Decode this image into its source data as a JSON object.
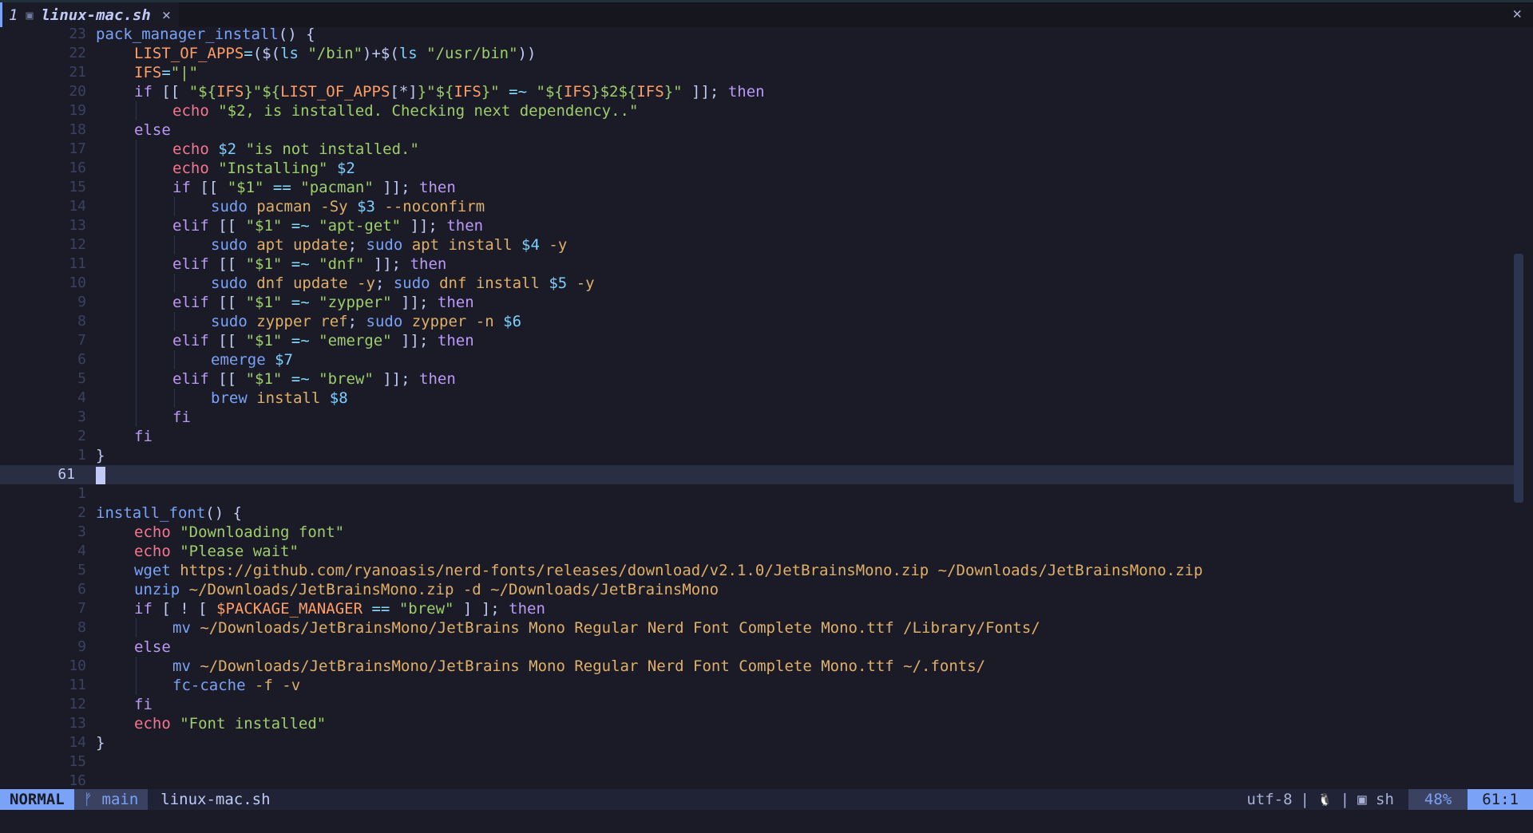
{
  "tab": {
    "number": "1",
    "filename": "linux-mac.sh",
    "close_glyph": "×"
  },
  "window_close_glyph": "✕",
  "lines": [
    {
      "n": "23",
      "code": "<span class=\"fn\">pack_manager_install</span><span class=\"p\">() {</span>"
    },
    {
      "n": "22",
      "indent": 1,
      "code": "<span class=\"c\">LIST_OF_APPS</span><span class=\"o\">=</span><span class=\"p\">($(</span><span class=\"f\">ls</span> <span class=\"s\">\"/bin\"</span><span class=\"p\">)+$(</span><span class=\"f\">ls</span> <span class=\"s\">\"/usr/bin\"</span><span class=\"p\">))</span>"
    },
    {
      "n": "21",
      "indent": 1,
      "code": "<span class=\"c\">IFS</span><span class=\"o\">=</span><span class=\"s\">\"|\"</span>"
    },
    {
      "n": "20",
      "indent": 1,
      "code": "<span class=\"k\">if</span> <span class=\"p\">[[</span> <span class=\"s\">\"${</span><span class=\"c\">IFS</span><span class=\"s\">}\"${</span><span class=\"c\">LIST_OF_APPS</span><span class=\"p\">[*]</span><span class=\"s\">}\"${</span><span class=\"c\">IFS</span><span class=\"s\">}\"</span> <span class=\"o\">=~</span> <span class=\"s\">\"${</span><span class=\"c\">IFS</span><span class=\"s\">}$2${</span><span class=\"c\">IFS</span><span class=\"s\">}\"</span> <span class=\"p\">]];</span> <span class=\"k\">then</span>"
    },
    {
      "n": "19",
      "indent": 2,
      "code": "<span class=\"e\">echo</span> <span class=\"s\">\"$2, is installed. Checking next dependency..\"</span>"
    },
    {
      "n": "18",
      "indent": 1,
      "code": "<span class=\"k\">else</span>"
    },
    {
      "n": "17",
      "indent": 2,
      "code": "<span class=\"e\">echo</span> <span class=\"f\">$2</span> <span class=\"s\">\"is not installed.\"</span>"
    },
    {
      "n": "16",
      "indent": 2,
      "code": "<span class=\"e\">echo</span> <span class=\"s\">\"Installing\"</span> <span class=\"f\">$2</span>"
    },
    {
      "n": "15",
      "indent": 2,
      "code": "<span class=\"k\">if</span> <span class=\"p\">[[</span> <span class=\"s\">\"$1\"</span> <span class=\"o\">==</span> <span class=\"s\">\"pacman\"</span> <span class=\"p\">]];</span> <span class=\"k\">then</span>"
    },
    {
      "n": "14",
      "indent": 3,
      "code": "<span class=\"fn\">sudo</span> <span class=\"y\">pacman -Sy</span> <span class=\"f\">$3</span> <span class=\"y\">--noconfirm</span>"
    },
    {
      "n": "13",
      "indent": 2,
      "code": "<span class=\"k\">elif</span> <span class=\"p\">[[</span> <span class=\"s\">\"$1\"</span> <span class=\"o\">=~</span> <span class=\"s\">\"apt-get\"</span> <span class=\"p\">]];</span> <span class=\"k\">then</span>"
    },
    {
      "n": "12",
      "indent": 3,
      "code": "<span class=\"fn\">sudo</span> <span class=\"y\">apt update</span><span class=\"p\">;</span> <span class=\"fn\">sudo</span> <span class=\"y\">apt install</span> <span class=\"f\">$4</span> <span class=\"y\">-y</span>"
    },
    {
      "n": "11",
      "indent": 2,
      "code": "<span class=\"k\">elif</span> <span class=\"p\">[[</span> <span class=\"s\">\"$1\"</span> <span class=\"o\">=~</span> <span class=\"s\">\"dnf\"</span> <span class=\"p\">]];</span> <span class=\"k\">then</span>"
    },
    {
      "n": "10",
      "indent": 3,
      "code": "<span class=\"fn\">sudo</span> <span class=\"y\">dnf update -y</span><span class=\"p\">;</span> <span class=\"fn\">sudo</span> <span class=\"y\">dnf install</span> <span class=\"f\">$5</span> <span class=\"y\">-y</span>"
    },
    {
      "n": "9",
      "indent": 2,
      "code": "<span class=\"k\">elif</span> <span class=\"p\">[[</span> <span class=\"s\">\"$1\"</span> <span class=\"o\">=~</span> <span class=\"s\">\"zypper\"</span> <span class=\"p\">]];</span> <span class=\"k\">then</span>"
    },
    {
      "n": "8",
      "indent": 3,
      "code": "<span class=\"fn\">sudo</span> <span class=\"y\">zypper ref</span><span class=\"p\">;</span> <span class=\"fn\">sudo</span> <span class=\"y\">zypper -n</span> <span class=\"f\">$6</span>"
    },
    {
      "n": "7",
      "indent": 2,
      "code": "<span class=\"k\">elif</span> <span class=\"p\">[[</span> <span class=\"s\">\"$1\"</span> <span class=\"o\">=~</span> <span class=\"s\">\"emerge\"</span> <span class=\"p\">]];</span> <span class=\"k\">then</span>"
    },
    {
      "n": "6",
      "indent": 3,
      "code": "<span class=\"fn\">emerge</span> <span class=\"f\">$7</span>"
    },
    {
      "n": "5",
      "indent": 2,
      "code": "<span class=\"k\">elif</span> <span class=\"p\">[[</span> <span class=\"s\">\"$1\"</span> <span class=\"o\">=~</span> <span class=\"s\">\"brew\"</span> <span class=\"p\">]];</span> <span class=\"k\">then</span>"
    },
    {
      "n": "4",
      "indent": 3,
      "code": "<span class=\"fn\">brew</span> <span class=\"y\">install</span> <span class=\"f\">$8</span>"
    },
    {
      "n": "3",
      "indent": 2,
      "code": "<span class=\"k\">fi</span>"
    },
    {
      "n": "2",
      "indent": 1,
      "code": "<span class=\"k\">fi</span>"
    },
    {
      "n": "1",
      "code": "<span class=\"p\">}</span>"
    },
    {
      "n": "61",
      "cur": true,
      "code": ""
    },
    {
      "n": "1",
      "code": ""
    },
    {
      "n": "2",
      "code": "<span class=\"fn\">install_font</span><span class=\"p\">() {</span>"
    },
    {
      "n": "3",
      "indent": 1,
      "code": "<span class=\"e\">echo</span> <span class=\"s\">\"Downloading font\"</span>"
    },
    {
      "n": "4",
      "indent": 1,
      "code": "<span class=\"e\">echo</span> <span class=\"s\">\"Please wait\"</span>"
    },
    {
      "n": "5",
      "indent": 1,
      "code": "<span class=\"fn\">wget</span> <span class=\"y\">https://github.com/ryanoasis/nerd-fonts/releases/download/v2.1.0/JetBrainsMono.zip ~/Downloads/JetBrainsMono.zip</span>"
    },
    {
      "n": "6",
      "indent": 1,
      "code": "<span class=\"fn\">unzip</span> <span class=\"y\">~/Downloads/JetBrainsMono.zip -d ~/Downloads/JetBrainsMono</span>"
    },
    {
      "n": "7",
      "indent": 1,
      "code": "<span class=\"k\">if</span> <span class=\"p\">[ ! [</span> <span class=\"c\">$PACKAGE_MANAGER</span> <span class=\"o\">==</span> <span class=\"s\">\"brew\"</span> <span class=\"p\">] ];</span> <span class=\"k\">then</span>"
    },
    {
      "n": "8",
      "indent": 2,
      "code": "<span class=\"fn\">mv</span> <span class=\"y\">~/Downloads/JetBrainsMono/JetBrains Mono Regular Nerd Font Complete Mono.ttf /Library/Fonts/</span>"
    },
    {
      "n": "9",
      "indent": 1,
      "code": "<span class=\"k\">else</span>"
    },
    {
      "n": "10",
      "indent": 2,
      "code": "<span class=\"fn\">mv</span> <span class=\"y\">~/Downloads/JetBrainsMono/JetBrains Mono Regular Nerd Font Complete Mono.ttf ~/.fonts/</span>"
    },
    {
      "n": "11",
      "indent": 2,
      "code": "<span class=\"fn\">fc-cache</span> <span class=\"y\">-f -v</span>"
    },
    {
      "n": "12",
      "indent": 1,
      "code": "<span class=\"k\">fi</span>"
    },
    {
      "n": "13",
      "indent": 1,
      "code": "<span class=\"e\">echo</span> <span class=\"s\">\"Font installed\"</span>"
    },
    {
      "n": "14",
      "code": "<span class=\"p\">}</span>"
    },
    {
      "n": "15",
      "code": ""
    },
    {
      "n": "16",
      "code": ""
    }
  ],
  "status": {
    "mode": "NORMAL",
    "branch_icon": "ᚠ",
    "branch": "main",
    "filename": "linux-mac.sh",
    "encoding": "utf-8",
    "separator": "|",
    "os_icon": "🐧",
    "filetype_icon": "▣",
    "filetype": "sh",
    "percent": "48%",
    "position": "61:1"
  }
}
